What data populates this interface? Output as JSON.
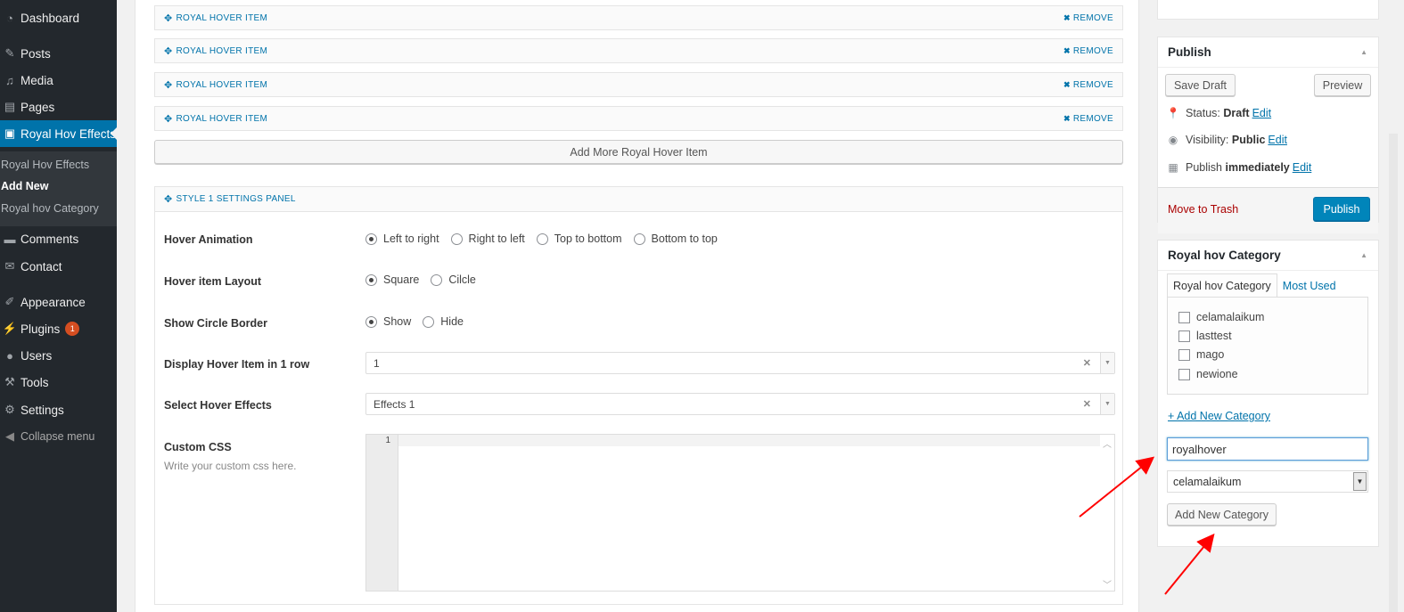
{
  "sidebar": {
    "items": [
      {
        "label": "Dashboard",
        "icon": "dashboard-icon"
      },
      {
        "label": "Posts",
        "icon": "pin-icon"
      },
      {
        "label": "Media",
        "icon": "media-icon"
      },
      {
        "label": "Pages",
        "icon": "page-icon"
      },
      {
        "label": "Royal Hov Effects",
        "icon": "gallery-icon"
      },
      {
        "label": "Comments",
        "icon": "comment-icon"
      },
      {
        "label": "Contact",
        "icon": "mail-icon"
      },
      {
        "label": "Appearance",
        "icon": "brush-icon"
      },
      {
        "label": "Plugins",
        "icon": "plug-icon",
        "badge": "1"
      },
      {
        "label": "Users",
        "icon": "user-icon"
      },
      {
        "label": "Tools",
        "icon": "wrench-icon"
      },
      {
        "label": "Settings",
        "icon": "settings-icon"
      }
    ],
    "submenu": [
      "Royal Hov Effects",
      "Add New",
      "Royal hov Category"
    ],
    "collapse_label": "Collapse menu"
  },
  "repeater": {
    "rows": [
      {
        "title": "ROYAL HOVER ITEM",
        "remove": "REMOVE"
      },
      {
        "title": "ROYAL HOVER ITEM",
        "remove": "REMOVE"
      },
      {
        "title": "ROYAL HOVER ITEM",
        "remove": "REMOVE"
      },
      {
        "title": "ROYAL HOVER ITEM",
        "remove": "REMOVE"
      }
    ],
    "add_more_label": "Add More Royal Hover Item"
  },
  "settings_panel": {
    "title": "STYLE 1 SETTINGS PANEL",
    "hover_animation": {
      "label": "Hover Animation",
      "options": [
        "Left to right",
        "Right to left",
        "Top to bottom",
        "Bottom to top"
      ],
      "selected": "Left to right"
    },
    "layout": {
      "label": "Hover item Layout",
      "options": [
        "Square",
        "Cilcle"
      ],
      "selected": "Square"
    },
    "circle_border": {
      "label": "Show Circle Border",
      "options": [
        "Show",
        "Hide"
      ],
      "selected": "Show"
    },
    "items_per_row": {
      "label": "Display Hover Item in 1 row",
      "value": "1"
    },
    "effects": {
      "label": "Select Hover Effects",
      "value": "Effects 1"
    },
    "custom_css": {
      "label": "Custom CSS",
      "hint": "Write your custom css here.",
      "line_number": "1",
      "value": ""
    }
  },
  "publish": {
    "title": "Publish",
    "save_draft": "Save Draft",
    "preview": "Preview",
    "status_label": "Status:",
    "status_value": "Draft",
    "visibility_label": "Visibility:",
    "visibility_value": "Public",
    "schedule_label": "Publish",
    "schedule_value": "immediately",
    "edit": "Edit",
    "trash": "Move to Trash",
    "publish_button": "Publish"
  },
  "category_box": {
    "title": "Royal hov Category",
    "tabs": [
      "Royal hov Category",
      "Most Used"
    ],
    "categories": [
      "celamalaikum",
      "lasttest",
      "mago",
      "newione"
    ],
    "add_new_link": "+ Add New Category",
    "new_category_value": "royalhover",
    "parent_value": "celamalaikum",
    "add_button": "Add New Category"
  },
  "colors": {
    "admin_bar": "#23282d",
    "accent": "#0073aa",
    "publish_button": "#0085ba",
    "trash": "#a00000",
    "annotation_arrow": "#ff0000"
  }
}
